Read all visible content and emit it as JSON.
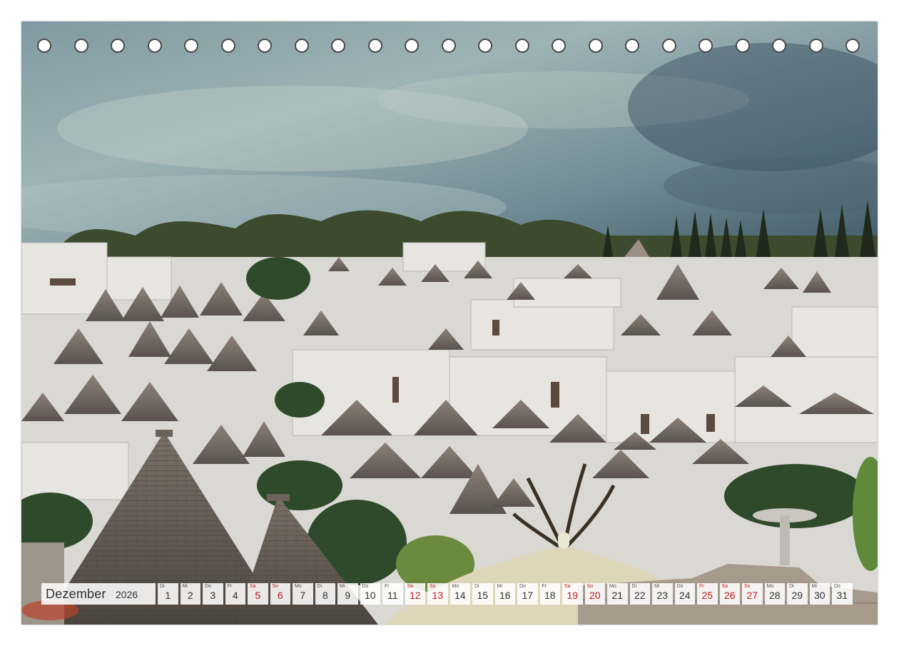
{
  "calendar": {
    "month": "Dezember",
    "year": "2026",
    "red_color": "#c4181f",
    "days": [
      {
        "wd": "Di",
        "num": "1",
        "red": false
      },
      {
        "wd": "Mi",
        "num": "2",
        "red": false
      },
      {
        "wd": "Do",
        "num": "3",
        "red": false
      },
      {
        "wd": "Fr",
        "num": "4",
        "red": false
      },
      {
        "wd": "Sa",
        "num": "5",
        "red": true
      },
      {
        "wd": "So",
        "num": "6",
        "red": true
      },
      {
        "wd": "Mo",
        "num": "7",
        "red": false
      },
      {
        "wd": "Di",
        "num": "8",
        "red": false
      },
      {
        "wd": "Mi",
        "num": "9",
        "red": false
      },
      {
        "wd": "Do",
        "num": "10",
        "red": false
      },
      {
        "wd": "Fr",
        "num": "11",
        "red": false
      },
      {
        "wd": "Sa",
        "num": "12",
        "red": true
      },
      {
        "wd": "So",
        "num": "13",
        "red": true
      },
      {
        "wd": "Mo",
        "num": "14",
        "red": false
      },
      {
        "wd": "Di",
        "num": "15",
        "red": false
      },
      {
        "wd": "Mi",
        "num": "16",
        "red": false
      },
      {
        "wd": "Do",
        "num": "17",
        "red": false
      },
      {
        "wd": "Fr",
        "num": "18",
        "red": false
      },
      {
        "wd": "Sa",
        "num": "19",
        "red": true
      },
      {
        "wd": "So",
        "num": "20",
        "red": true
      },
      {
        "wd": "Mo",
        "num": "21",
        "red": false
      },
      {
        "wd": "Di",
        "num": "22",
        "red": false
      },
      {
        "wd": "Mi",
        "num": "23",
        "red": false
      },
      {
        "wd": "Do",
        "num": "24",
        "red": false
      },
      {
        "wd": "Fr",
        "num": "25",
        "red": true
      },
      {
        "wd": "Sa",
        "num": "26",
        "red": true
      },
      {
        "wd": "So",
        "num": "27",
        "red": true
      },
      {
        "wd": "Mo",
        "num": "28",
        "red": false
      },
      {
        "wd": "Di",
        "num": "29",
        "red": false
      },
      {
        "wd": "Mi",
        "num": "30",
        "red": false
      },
      {
        "wd": "Do",
        "num": "31",
        "red": false
      }
    ]
  }
}
